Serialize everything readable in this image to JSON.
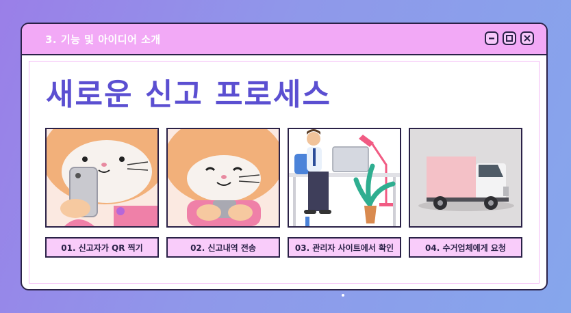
{
  "window": {
    "title": "3. 기능 및 아이디어 소개",
    "heading": "새로운 신고 프로세스"
  },
  "controls": [
    "minimize-icon",
    "maximize-icon",
    "close-icon"
  ],
  "steps": [
    {
      "label": "01. 신고자가  QR 찍기",
      "image": "cat-holding-phone-image"
    },
    {
      "label": "02. 신고내역 전송",
      "image": "cat-typing-phone-image"
    },
    {
      "label": "03. 관리자 사이트에서 확인",
      "image": "admin-at-desk-image"
    },
    {
      "label": "04. 수거업체에게 요청",
      "image": "pink-truck-image"
    }
  ],
  "colors": {
    "title_bar": "#f2a9f6",
    "heading": "#5b4fd1",
    "label_bg": "#f9ccfa",
    "outline": "#2a2147"
  }
}
